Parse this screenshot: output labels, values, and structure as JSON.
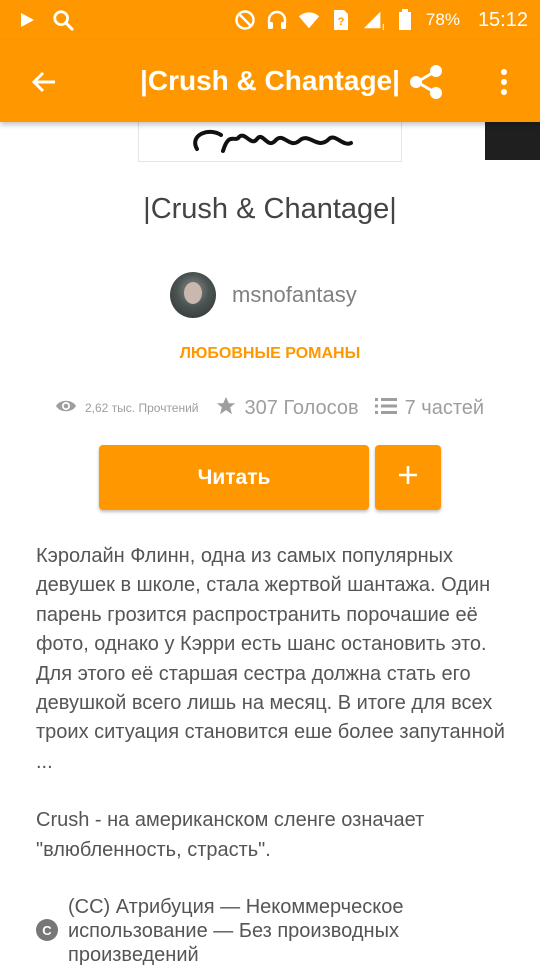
{
  "status_bar": {
    "battery": "78%",
    "time": "15:12"
  },
  "app_bar": {
    "title": "|Crush & Chantage|"
  },
  "story": {
    "title": "|Crush & Chantage|",
    "author": "msnofantasy",
    "category": "ЛЮБОВНЫЕ РОМАНЫ",
    "reads": "2,62 тыс. Прочтений",
    "votes": "307 Голосов",
    "parts": "7 частей",
    "read_button": "Читать",
    "description_1": "Кэролайн Флинн, одна из самых популярных девушек в школе, стала жертвой шантажа. Один парень грозится распространить порочашие её фото, однако у Кэрри есть шанс остановить это. Для этого её старшая сестра должна стать его девушкой всего лишь на месяц. В итоге для всех троих ситуация становится еше более запутанной ...",
    "description_2": "Crush - на американском сленге означает \"влюбленность, страсть\".",
    "license": "(CC) Атрибуция — Некоммерческое использование — Без производных произведений",
    "license_badge": "C"
  },
  "colors": {
    "accent": "#ff9800",
    "text_gray": "#555555",
    "muted": "#9e9e9e"
  },
  "icons": {
    "status_left": [
      "play-icon",
      "search-icon"
    ],
    "status_right": [
      "do-not-disturb-icon",
      "headphones-icon",
      "wifi-icon",
      "sim-icon",
      "signal-icon",
      "battery-icon"
    ],
    "app_bar": [
      "back-arrow-icon",
      "share-icon",
      "more-vert-icon"
    ],
    "stats": [
      "eye-icon",
      "star-icon",
      "list-icon"
    ],
    "add": "plus-icon"
  }
}
